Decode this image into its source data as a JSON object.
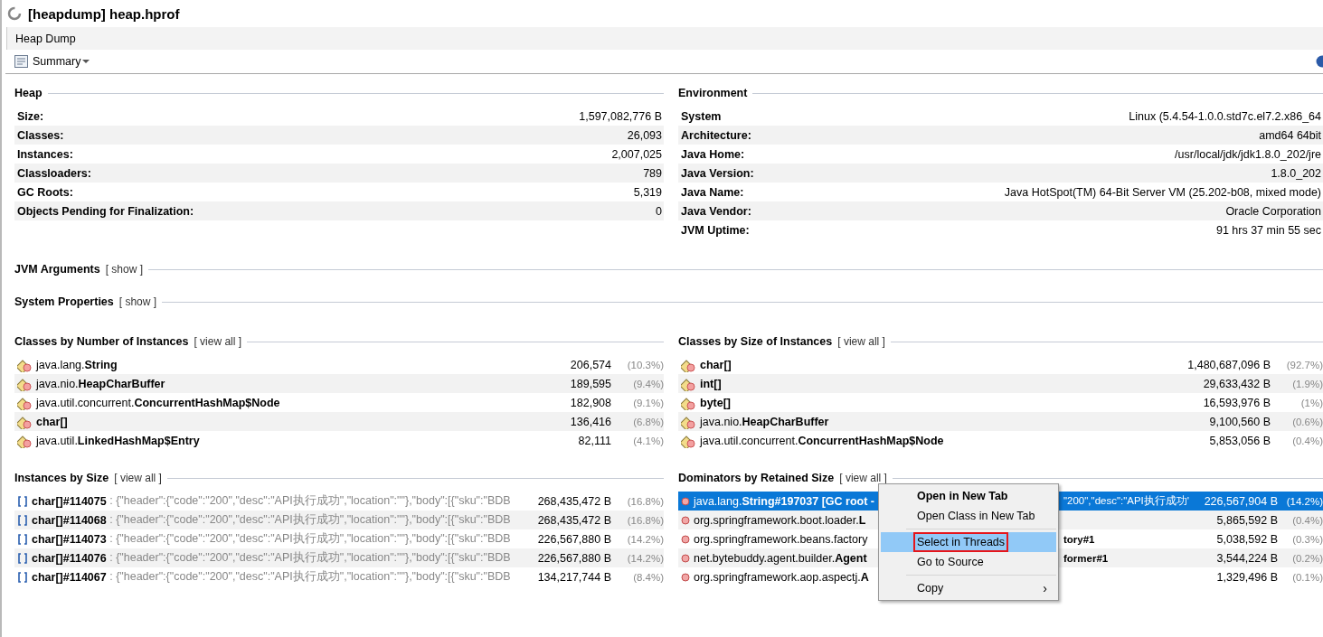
{
  "window": {
    "title": "[heapdump] heap.hprof",
    "busy": true
  },
  "tabs": [
    {
      "label": "Heap Dump",
      "selected": true
    }
  ],
  "toolbar": {
    "view": "Summary"
  },
  "heap": {
    "title": "Heap",
    "rows": [
      {
        "label": "Size:",
        "value": "1,597,082,776 B"
      },
      {
        "label": "Classes:",
        "value": "26,093"
      },
      {
        "label": "Instances:",
        "value": "2,007,025"
      },
      {
        "label": "Classloaders:",
        "value": "789"
      },
      {
        "label": "GC Roots:",
        "value": "5,319"
      },
      {
        "label": "Objects Pending for Finalization:",
        "value": "0"
      }
    ]
  },
  "environment": {
    "title": "Environment",
    "rows": [
      {
        "label": "System",
        "value": "Linux (5.4.54-1.0.0.std7c.el7.2.x86_64"
      },
      {
        "label": "Architecture:",
        "value": "amd64 64bit"
      },
      {
        "label": "Java Home:",
        "value": "/usr/local/jdk/jdk1.8.0_202/jre"
      },
      {
        "label": "Java Version:",
        "value": "1.8.0_202"
      },
      {
        "label": "Java Name:",
        "value": "Java HotSpot(TM) 64-Bit Server VM (25.202-b08, mixed mode)"
      },
      {
        "label": "Java Vendor:",
        "value": "Oracle Corporation"
      },
      {
        "label": "JVM Uptime:",
        "value": "91 hrs 37 min 55 sec"
      }
    ]
  },
  "jvm_arguments": {
    "title": "JVM Arguments",
    "link": "[ show ]"
  },
  "system_properties": {
    "title": "System Properties",
    "link": "[ show ]"
  },
  "classes_by_number": {
    "title": "Classes by Number of Instances",
    "link": "[ view all ]",
    "rows": [
      {
        "name": "java.lang.**String**",
        "value": "206,574",
        "percent": "(10.3%)"
      },
      {
        "name": "java.nio.**HeapCharBuffer**",
        "value": "189,595",
        "percent": "(9.4%)"
      },
      {
        "name": "java.util.concurrent.**ConcurrentHashMap$Node**",
        "value": "182,908",
        "percent": "(9.1%)"
      },
      {
        "name": "**char[]**",
        "value": "136,416",
        "percent": "(6.8%)"
      },
      {
        "name": "java.util.**LinkedHashMap$Entry**",
        "value": "82,111",
        "percent": "(4.1%)"
      }
    ]
  },
  "classes_by_size": {
    "title": "Classes by Size of Instances",
    "link": "[ view all ]",
    "rows": [
      {
        "name": "**char[]**",
        "value": "1,480,687,096 B",
        "percent": "(92.7%)"
      },
      {
        "name": "**int[]**",
        "value": "29,633,432 B",
        "percent": "(1.9%)"
      },
      {
        "name": "**byte[]**",
        "value": "16,593,976 B",
        "percent": "(1%)"
      },
      {
        "name": "java.nio.**HeapCharBuffer**",
        "value": "9,100,560 B",
        "percent": "(0.6%)"
      },
      {
        "name": "java.util.concurrent.**ConcurrentHashMap$Node**",
        "value": "5,853,056 B",
        "percent": "(0.4%)"
      }
    ]
  },
  "instances_by_size": {
    "title": "Instances by Size",
    "link": "[ view all ]",
    "rows": [
      {
        "name": "char[]#114075",
        "preview": ": {\"header\":{\"code\":\"200\",\"desc\":\"API执行成功\",\"location\":\"\"},\"body\":[{\"sku\":\"BDB",
        "value": "268,435,472 B",
        "percent": "(16.8%)"
      },
      {
        "name": "char[]#114068",
        "preview": ": {\"header\":{\"code\":\"200\",\"desc\":\"API执行成功\",\"location\":\"\"},\"body\":[{\"sku\":\"BDB",
        "value": "268,435,472 B",
        "percent": "(16.8%)"
      },
      {
        "name": "char[]#114073",
        "preview": ": {\"header\":{\"code\":\"200\",\"desc\":\"API执行成功\",\"location\":\"\"},\"body\":[{\"sku\":\"BDB",
        "value": "226,567,880 B",
        "percent": "(14.2%)"
      },
      {
        "name": "char[]#114076",
        "preview": ": {\"header\":{\"code\":\"200\",\"desc\":\"API执行成功\",\"location\":\"\"},\"body\":[{\"sku\":\"BDB",
        "value": "226,567,880 B",
        "percent": "(14.2%)"
      },
      {
        "name": "char[]#114067",
        "preview": ": {\"header\":{\"code\":\"200\",\"desc\":\"API执行成功\",\"location\":\"\"},\"body\":[{\"sku\":\"BDB",
        "value": "134,217,744 B",
        "percent": "(8.4%)"
      }
    ]
  },
  "dominators": {
    "title": "Dominators by Retained Size",
    "link": "[ view all ]",
    "rows": [
      {
        "name": "java.lang.**String#197037 [GC root -**",
        "tail": "\"200\",\"desc\":\"API执行成功'",
        "value": "226,567,904 B",
        "percent": "(14.2%)",
        "selected": true
      },
      {
        "name": "org.springframework.boot.loader.**L**",
        "value": "5,865,592 B",
        "percent": "(0.4%)",
        "selected": false
      },
      {
        "name": "org.springframework.beans.factory",
        "tail": "**tory#1**",
        "value": "5,038,592 B",
        "percent": "(0.3%)",
        "selected": false
      },
      {
        "name": "net.bytebuddy.agent.builder.**Agent**",
        "tail": "**former#1**",
        "value": "3,544,224 B",
        "percent": "(0.2%)",
        "selected": false
      },
      {
        "name": "org.springframework.aop.aspectj.**A**",
        "value": "1,329,496 B",
        "percent": "(0.1%)",
        "selected": false
      }
    ]
  },
  "context_menu": {
    "items": [
      {
        "kind": "item",
        "label": "Open in New Tab",
        "default": true,
        "selected": false,
        "outlined": false
      },
      {
        "kind": "item",
        "label": "Open Class in New Tab",
        "default": false,
        "selected": false,
        "outlined": false
      },
      {
        "kind": "separator"
      },
      {
        "kind": "item",
        "label": "Select in Threads",
        "default": false,
        "selected": true,
        "outlined": true
      },
      {
        "kind": "item",
        "label": "Go to Source",
        "default": false,
        "selected": false,
        "outlined": false
      },
      {
        "kind": "separator"
      },
      {
        "kind": "item",
        "label": "Copy",
        "default": false,
        "selected": false,
        "outlined": false,
        "submenu_arrow": "›"
      }
    ]
  }
}
